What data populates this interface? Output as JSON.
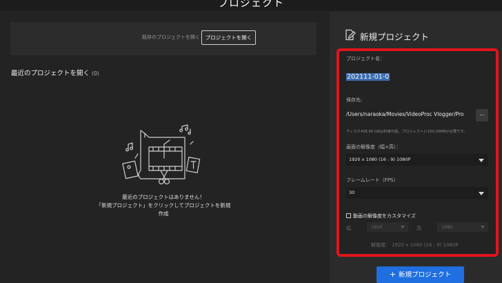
{
  "window": {
    "title": "プロジェクト"
  },
  "left_panel": {
    "open_hint": "既存のプロジェクトを開く",
    "open_button": "プロジェクトを開く",
    "recent_title": "最近のプロジェクトを開く",
    "recent_count": "(0)",
    "empty_message_line1": "最近のプロジェクトはありません！",
    "empty_message_line2": "「新規プロジェクト」をクリックしてプロジェクトを新規",
    "empty_message_line3": "作成"
  },
  "new_project": {
    "header": "新規プロジェクト",
    "name_label": "プロジェクト名：",
    "name_value": "202111-01-0",
    "path_label": "保存先:",
    "path_value": "/Users/naraoka/Movies/VideoProc Vlogger/Pro",
    "browse_button": "...",
    "disk_info": "ディスク438.60 GBは利用可能。プロジェクトに100.00MBが必要です。",
    "resolution_label": "画面の解像度（幅×高）：",
    "resolution_value": "1920 x 1080 (16 : 9) 1080P",
    "framerate_label": "フレームレート（FPS）",
    "framerate_value": "30",
    "custom_label": "動画の解像度をカスタマイズ",
    "width_label": "幅",
    "width_value": "1920",
    "height_label": "高",
    "height_value": "1080",
    "resolution_summary": "解像度：  1920 x 1080 (16 : 9) 1080P",
    "create_button": "新規プロジェクト",
    "create_icon": "plus-icon"
  },
  "colors": {
    "accent": "#1f6fe0",
    "highlight_border": "#e2141b",
    "selection": "#3c6db0"
  }
}
